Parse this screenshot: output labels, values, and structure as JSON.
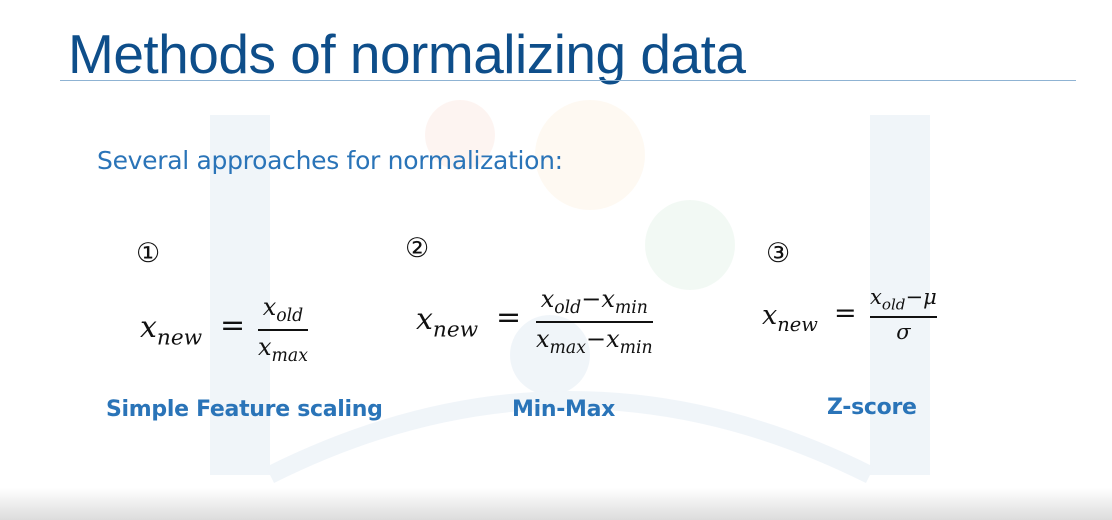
{
  "slide": {
    "title": "Methods of normalizing data",
    "subtitle": "Several approaches for normalization:"
  },
  "methods": [
    {
      "number": "①",
      "lhs": "x",
      "lhs_sub": "new",
      "equals": "=",
      "numerator": "x",
      "numerator_sub": "old",
      "denominator": "x",
      "denominator_sub": "max",
      "label": "Simple Feature scaling"
    },
    {
      "number": "②",
      "lhs": "x",
      "lhs_sub": "new",
      "equals": "=",
      "numerator_a": "x",
      "numerator_a_sub": "old",
      "numerator_op": "−",
      "numerator_b": "x",
      "numerator_b_sub": "min",
      "denominator_a": "x",
      "denominator_a_sub": "max",
      "denominator_op": "−",
      "denominator_b": "x",
      "denominator_b_sub": "min",
      "label": "Min-Max"
    },
    {
      "number": "③",
      "lhs": "x",
      "lhs_sub": "new",
      "equals": "=",
      "numerator_a": "x",
      "numerator_a_sub": "old",
      "numerator_op": "−",
      "numerator_b": "μ",
      "denominator": "σ",
      "label": "Z-score"
    }
  ]
}
